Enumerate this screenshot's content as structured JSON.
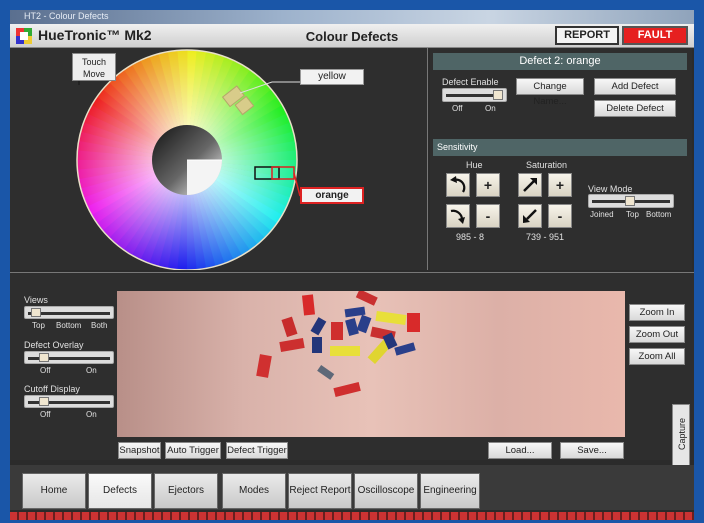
{
  "window": {
    "title": "HT2 - Colour Defects"
  },
  "header": {
    "brand": "HueTronic™ Mk2",
    "page_title": "Colour Defects",
    "report_label": "REPORT",
    "fault_label": "FAULT"
  },
  "wheel": {
    "touch_move": "Touch Move",
    "tags": {
      "yellow": "yellow",
      "orange": "orange"
    }
  },
  "defect": {
    "heading": "Defect 2: orange",
    "enable_label": "Defect Enable",
    "enable_off": "Off",
    "enable_on": "On",
    "change_name": "Change Name...",
    "add_defect": "Add Defect",
    "delete_defect": "Delete Defect"
  },
  "sensitivity": {
    "heading": "Sensitivity",
    "hue_label": "Hue",
    "saturation_label": "Saturation",
    "hue_range": "985 - 8",
    "saturation_range": "739 - 951",
    "view_mode_label": "View Mode",
    "view_mode_options": [
      "Joined",
      "Top",
      "Bottom"
    ]
  },
  "controls": {
    "views_label": "Views",
    "views_options": [
      "Top",
      "Bottom",
      "Both"
    ],
    "overlay_label": "Defect Overlay",
    "overlay_options": [
      "Off",
      "On"
    ],
    "cutoff_label": "Cutoff Display",
    "cutoff_options": [
      "Off",
      "On"
    ]
  },
  "zoom": {
    "zoom_in": "Zoom In",
    "zoom_out": "Zoom Out",
    "zoom_all": "Zoom All"
  },
  "capture_label": "Capture",
  "actions": {
    "snapshot": "Snapshot",
    "auto_trigger": "Auto Trigger",
    "defect_trigger": "Defect Trigger",
    "load": "Load...",
    "save": "Save..."
  },
  "tabs": [
    "Home",
    "Defects",
    "Ejectors",
    "Modes",
    "Reject Report",
    "Oscilloscope",
    "Engineering"
  ],
  "colors": {
    "fault": "#e62020",
    "panel_head": "#4f6566",
    "orange_tag_border": "#dd2222"
  }
}
